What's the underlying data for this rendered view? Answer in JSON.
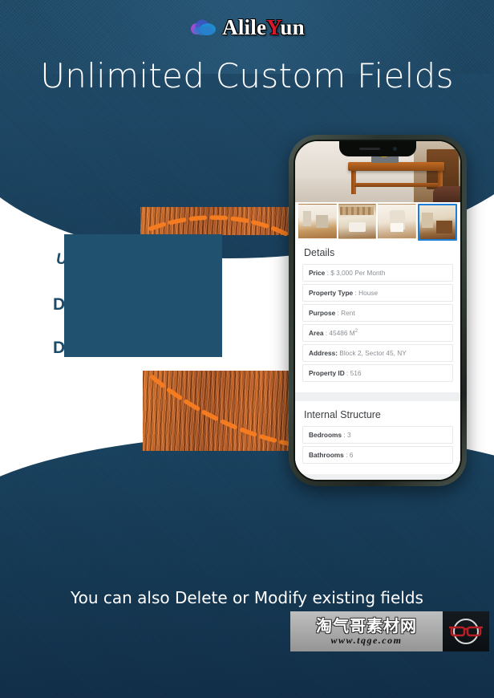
{
  "header": {
    "logo_text_part1": "Alile",
    "logo_text_accent": "Y",
    "logo_text_part2": "un",
    "logo_icon": "cloud-icon",
    "headline": "Unlimited Custom Fields"
  },
  "middle": {
    "line1": "U                                          s",
    "line2": "D                                           ns",
    "line3": "D                                        or",
    "redaction_color": "#20516f"
  },
  "phone": {
    "hero_image_alt": "wooden-coffee-table-living-room",
    "thumbnails": [
      {
        "name": "thumbnail-living-room",
        "selected": false
      },
      {
        "name": "thumbnail-bedroom-beams",
        "selected": false
      },
      {
        "name": "thumbnail-bedroom-canopy",
        "selected": false
      },
      {
        "name": "thumbnail-lounge",
        "selected": true
      }
    ],
    "details": {
      "title": "Details",
      "rows": [
        {
          "label": "Price",
          "sep": " : ",
          "value": "$ 3,000 Per Month"
        },
        {
          "label": "Property Type",
          "sep": " : ",
          "value": "House"
        },
        {
          "label": "Purpose",
          "sep": " : ",
          "value": "Rent"
        },
        {
          "label": "Area",
          "sep": " : ",
          "value": "45486 M",
          "sup": "2"
        },
        {
          "label": "Address:",
          "sep": " ",
          "value": "Block 2, Sector 45, NY"
        },
        {
          "label": "Property ID",
          "sep": " : ",
          "value": "516"
        }
      ]
    },
    "internal": {
      "title": "Internal Structure",
      "rows": [
        {
          "label": "Bedrooms",
          "sep": " : ",
          "value": "3"
        },
        {
          "label": "Bathrooms",
          "sep": " : ",
          "value": "6"
        }
      ]
    }
  },
  "footer": {
    "text": "You can also Delete or Modify existing fields"
  },
  "watermark": {
    "chinese": "淘气哥素材网",
    "url": "www.tqge.com",
    "logo": "glasses-icon"
  },
  "colors": {
    "background_blue": "#1c4462",
    "accent_orange": "#f47b20",
    "selection_blue": "#1c7ed6",
    "logo_red": "#d8192a",
    "text_blue": "#1d4c6a"
  }
}
